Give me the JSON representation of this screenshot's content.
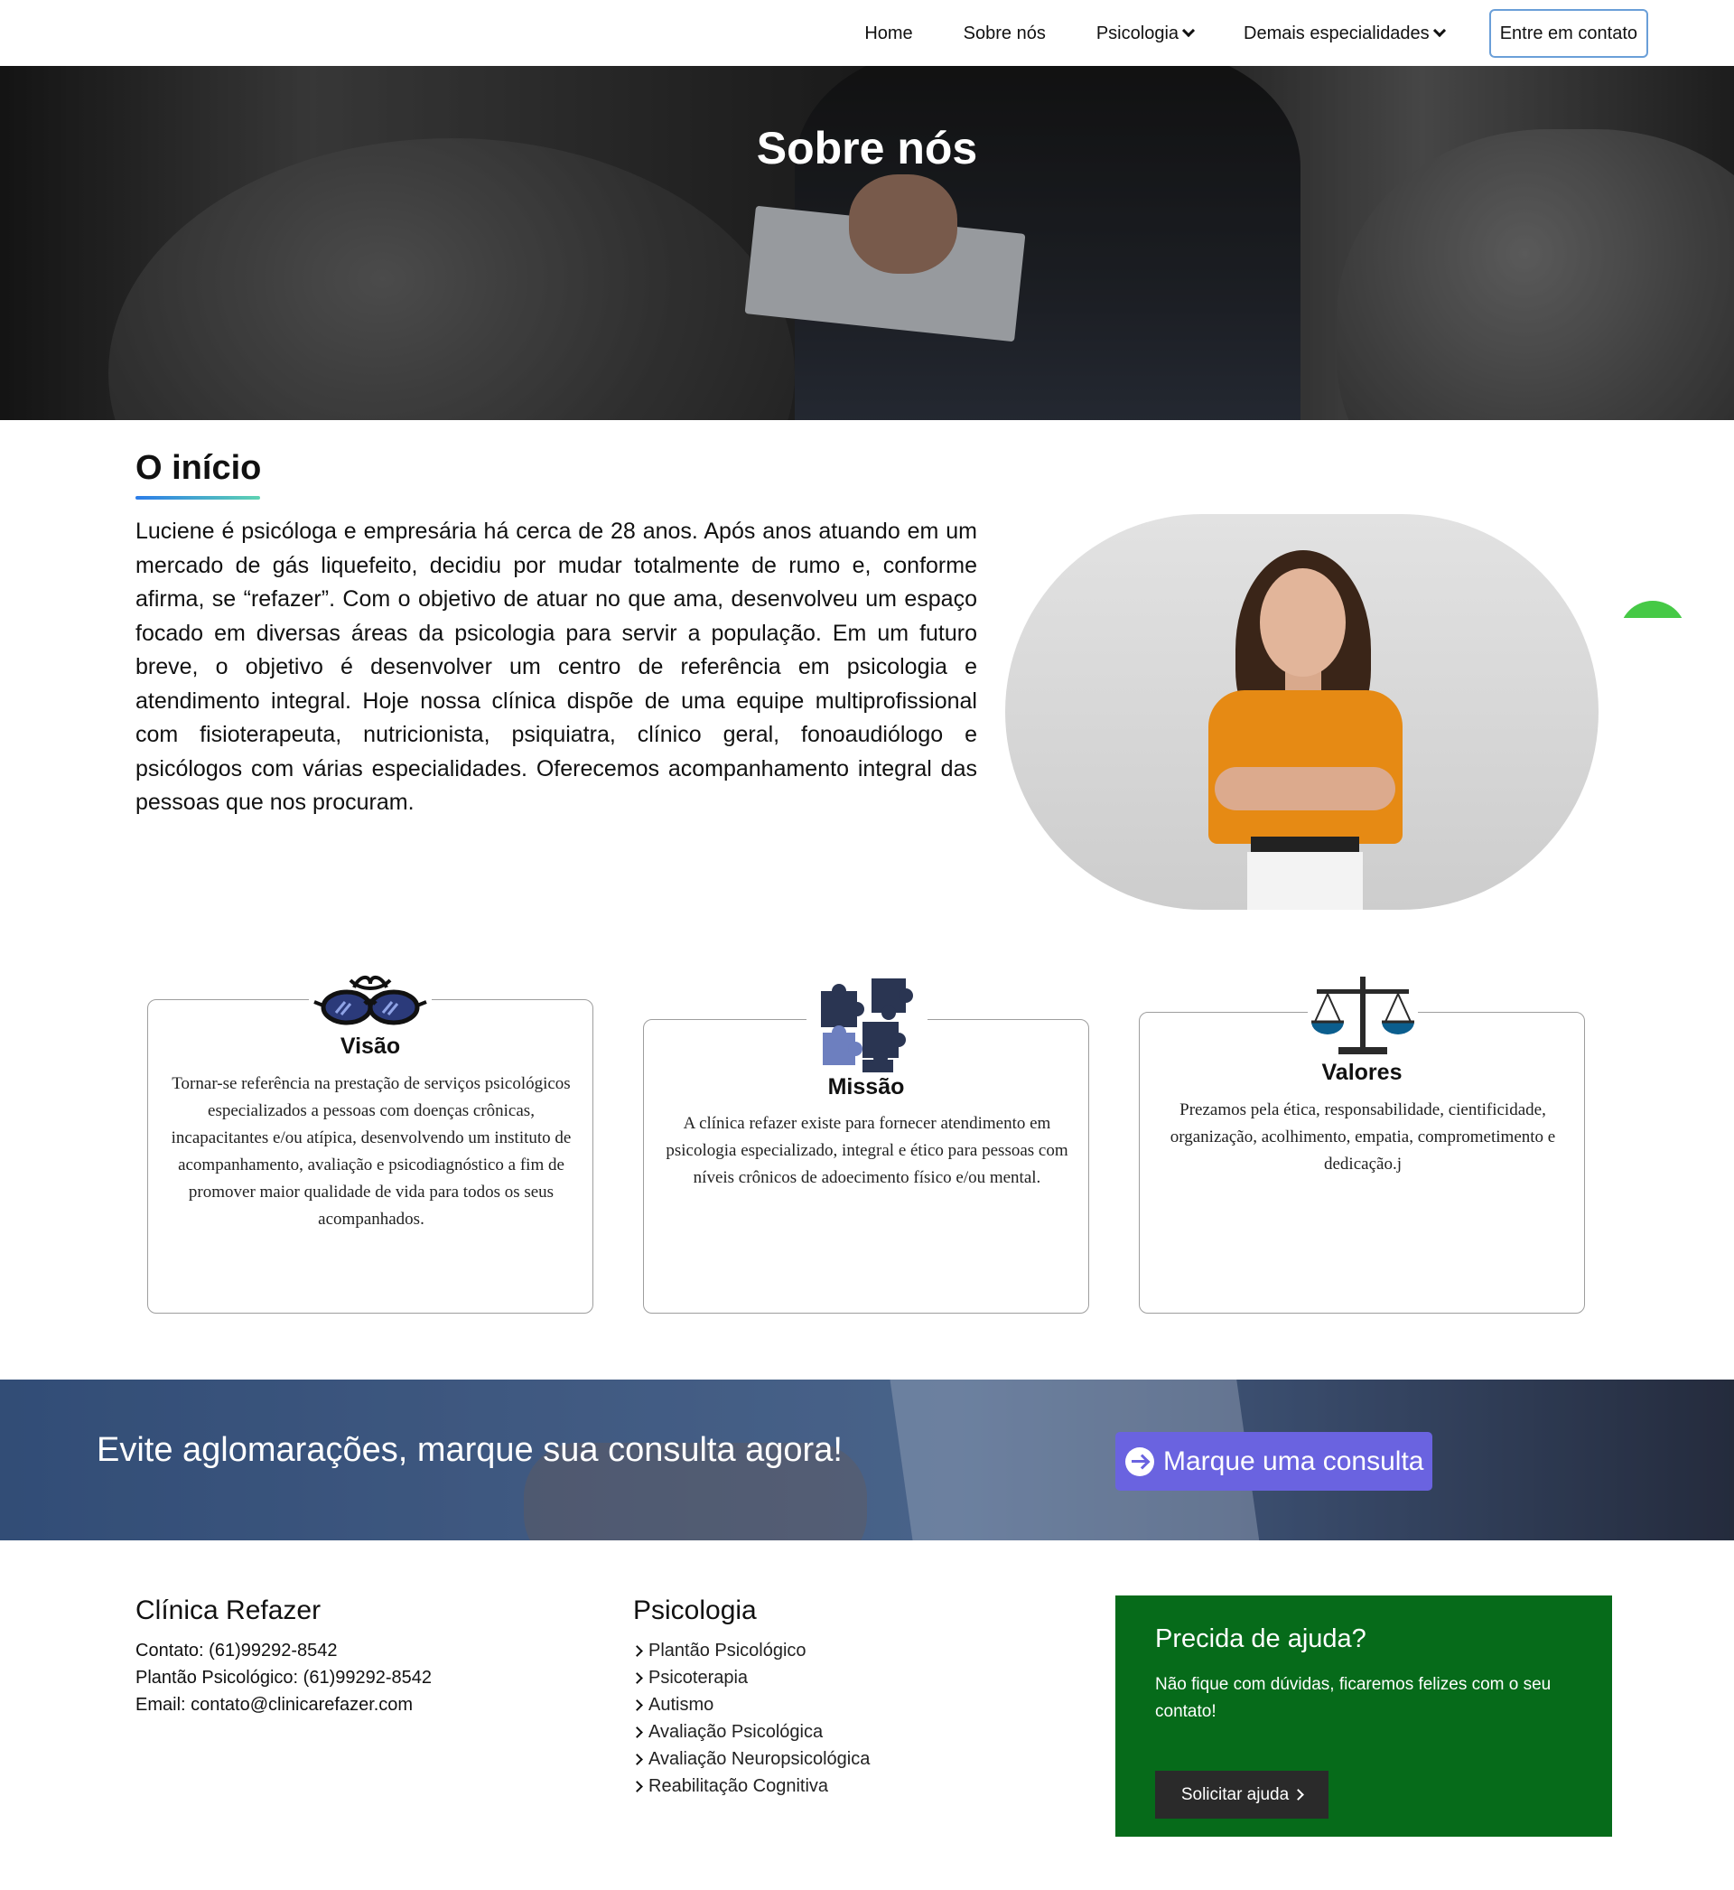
{
  "nav": {
    "items": [
      {
        "label": "Home"
      },
      {
        "label": "Sobre nós"
      },
      {
        "label": "Psicologia",
        "icon": "chevron-down-icon"
      },
      {
        "label": "Demais especialidades",
        "icon": "chevron-down-icon"
      }
    ],
    "contact_label": "Entre em contato"
  },
  "hero": {
    "title": "Sobre nós"
  },
  "inicio": {
    "title": "O início",
    "text": "Luciene é psicóloga e empresária há cerca de 28 anos. Após anos atuando em um mercado de gás liquefeito, decidiu por mudar totalmente de rumo e, conforme afirma, se “refazer”. Com o objetivo de atuar no que ama, desenvolveu um espaço focado em diversas áreas da psicologia para servir a população. Em um futuro breve, o objetivo é desenvolver um centro de referência em psicologia e atendimento integral. Hoje nossa clínica dispõe de uma equipe multiprofissional com fisioterapeuta, nutricionista, psiquiatra, clínico geral, fonoaudiólogo e psicólogos com várias especialidades. Oferecemos acompanhamento integral das pessoas que nos procuram."
  },
  "cards": [
    {
      "icon": "glasses-icon",
      "title": "Visão",
      "text": "Tornar-se referência na prestação de serviços psicológicos especializados a pessoas com doenças crônicas, incapacitantes e/ou atípica, desenvolvendo um instituto de acompanhamento, avaliação e psicodiagnóstico a fim de promover maior qualidade de vida para todos os seus acompanhados."
    },
    {
      "icon": "puzzle-icon",
      "title": "Missão",
      "text": "A clínica refazer existe para fornecer atendimento em psicologia especializado, integral e ético para pessoas com níveis crônicos de adoecimento físico e/ou mental."
    },
    {
      "icon": "scales-icon",
      "title": "Valores",
      "text": "Prezamos pela ética, responsabilidade, cientificidade, organização, acolhimento, empatia, comprometimento e dedicação.j"
    }
  ],
  "cta": {
    "text": "Evite aglomarações, marque sua consulta agora!",
    "button_label": "Marque uma consulta",
    "button_icon": "arrow-right-circle-icon"
  },
  "footer": {
    "clinic": {
      "title": "Clínica Refazer",
      "lines": [
        "Contato: (61)99292-8542",
        "Plantão Psicológico: (61)99292-8542",
        "Email: contato@clinicarefazer.com"
      ]
    },
    "psicologia": {
      "title": "Psicologia",
      "items": [
        "Plantão Psicológico",
        "Psicoterapia",
        "Autismo",
        "Avaliação Psicológica",
        "Avaliação Neuropsicológica",
        "Reabilitação Cognitiva"
      ]
    },
    "help": {
      "title": "Precida de ajuda?",
      "text": "Não fique com dúvidas, ficaremos felizes com o seu contato!",
      "button_label": "Solicitar ajuda"
    }
  },
  "colors": {
    "help_box": "#066b1a",
    "cta_button": "#6a63e0",
    "contact_border": "#6a9fd8",
    "underline_start": "#2b7ce9",
    "underline_end": "#5ed3b2"
  }
}
